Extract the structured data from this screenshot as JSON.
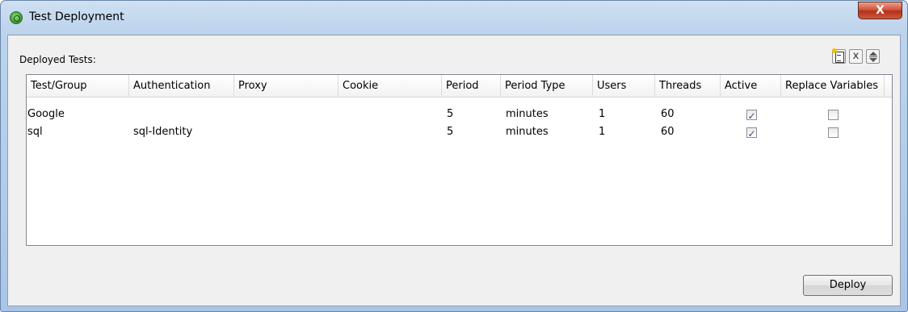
{
  "window": {
    "title": "Test Deployment",
    "close_label": "X"
  },
  "section": {
    "label": "Deployed Tests:"
  },
  "toolbar": {
    "delete_label": "x"
  },
  "table": {
    "headers": [
      "Test/Group",
      "Authentication",
      "Proxy",
      "Cookie",
      "Period",
      "Period Type",
      "Users",
      "Threads",
      "Active",
      "Replace Variables"
    ],
    "rows": [
      {
        "test_group": "Google",
        "authentication": "",
        "proxy": "",
        "cookie": "",
        "period": "5",
        "period_type": "minutes",
        "users": "1",
        "threads": "60",
        "active": true,
        "replace_variables": false
      },
      {
        "test_group": "sql",
        "authentication": "sql-Identity",
        "proxy": "",
        "cookie": "",
        "period": "5",
        "period_type": "minutes",
        "users": "1",
        "threads": "60",
        "active": true,
        "replace_variables": false
      }
    ]
  },
  "footer": {
    "deploy_label": "Deploy"
  },
  "colors": {
    "titlebar": "#bcd3ec",
    "close_button": "#c8452a",
    "checkbox_check": "#2b4b8f"
  }
}
